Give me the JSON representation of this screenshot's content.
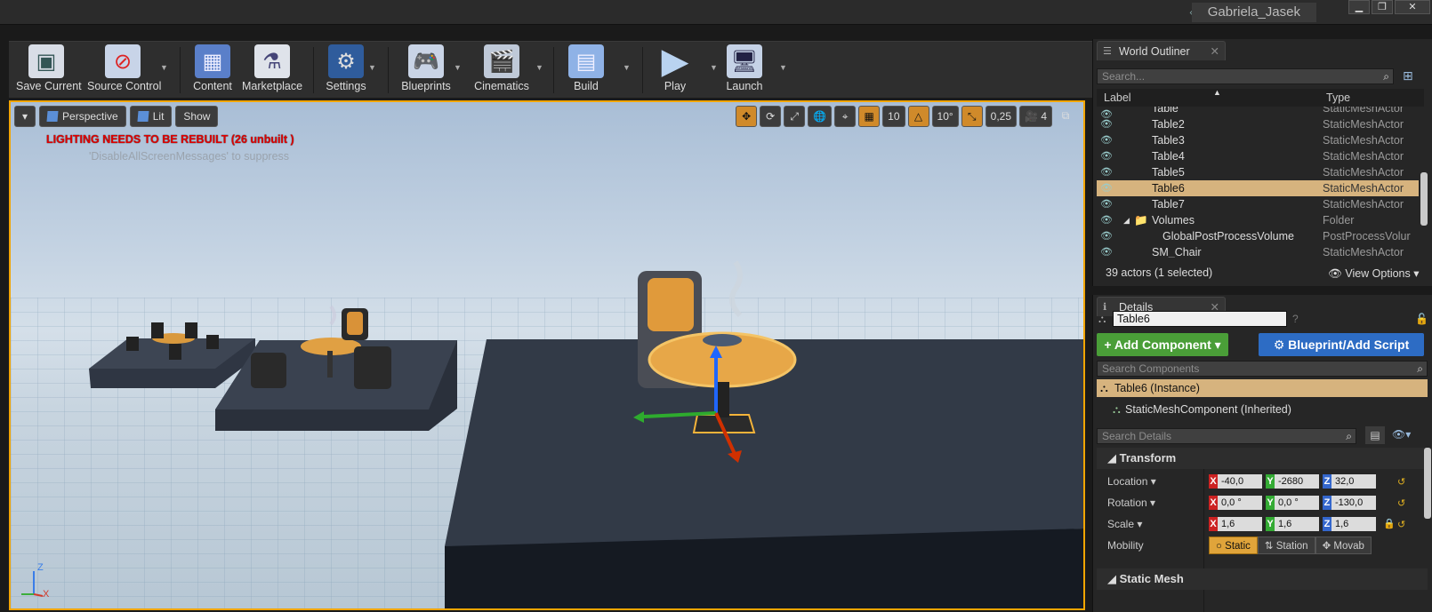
{
  "titlebar": {
    "user": "Gabriela_Jasek",
    "min": "▁",
    "max": "❐",
    "close": "✕"
  },
  "toolbar": {
    "items": [
      {
        "label": "Save Current"
      },
      {
        "label": "Source Control"
      },
      {
        "label": "Content"
      },
      {
        "label": "Marketplace"
      },
      {
        "label": "Settings"
      },
      {
        "label": "Blueprints"
      },
      {
        "label": "Cinematics"
      },
      {
        "label": "Build"
      },
      {
        "label": "Play"
      },
      {
        "label": "Launch"
      }
    ]
  },
  "viewport": {
    "perspective": "Perspective",
    "lit": "Lit",
    "show": "Show",
    "grid_snap": "10",
    "rot_snap": "10°",
    "scale_snap": "0,25",
    "cam_speed": "4",
    "warning": "LIGHTING NEEDS TO BE REBUILT (26 unbuilt )",
    "suppress": "'DisableAllScreenMessages' to suppress",
    "axis_z": "Z",
    "axis_x": "X"
  },
  "outliner": {
    "tab": "World Outliner",
    "search_placeholder": "Search...",
    "col_label": "Label",
    "col_type": "Type",
    "rows": [
      {
        "label": "Table",
        "type": "StaticMeshActor",
        "indent": 2
      },
      {
        "label": "Table2",
        "type": "StaticMeshActor",
        "indent": 2
      },
      {
        "label": "Table3",
        "type": "StaticMeshActor",
        "indent": 2
      },
      {
        "label": "Table4",
        "type": "StaticMeshActor",
        "indent": 2
      },
      {
        "label": "Table5",
        "type": "StaticMeshActor",
        "indent": 2
      },
      {
        "label": "Table6",
        "type": "StaticMeshActor",
        "indent": 2,
        "selected": true
      },
      {
        "label": "Table7",
        "type": "StaticMeshActor",
        "indent": 2
      },
      {
        "label": "Volumes",
        "type": "Folder",
        "indent": 1,
        "folder": true
      },
      {
        "label": "GlobalPostProcessVolume",
        "type": "PostProcessVolur",
        "indent": 2
      },
      {
        "label": "SM_Chair",
        "type": "StaticMeshActor",
        "indent": 1
      }
    ],
    "footer": "39 actors (1 selected)",
    "view_options": "View Options"
  },
  "details": {
    "tab": "Details",
    "name": "Table6",
    "add_component": "+ Add Component",
    "blueprint": "Blueprint/Add Script",
    "search_components": "Search Components",
    "instance": "Table6 (Instance)",
    "component": "StaticMeshComponent (Inherited)",
    "search_details": "Search Details",
    "transform": "Transform",
    "location_label": "Location",
    "rotation_label": "Rotation",
    "scale_label": "Scale",
    "mobility_label": "Mobility",
    "location": [
      "-40,0",
      "-2680",
      "32,0"
    ],
    "rotation": [
      "0,0 °",
      "0,0 °",
      "-130,0"
    ],
    "scale": [
      "1,6",
      "1,6",
      "1,6"
    ],
    "mobility": [
      "Static",
      "Station",
      "Movab"
    ],
    "static_mesh": "Static Mesh"
  }
}
